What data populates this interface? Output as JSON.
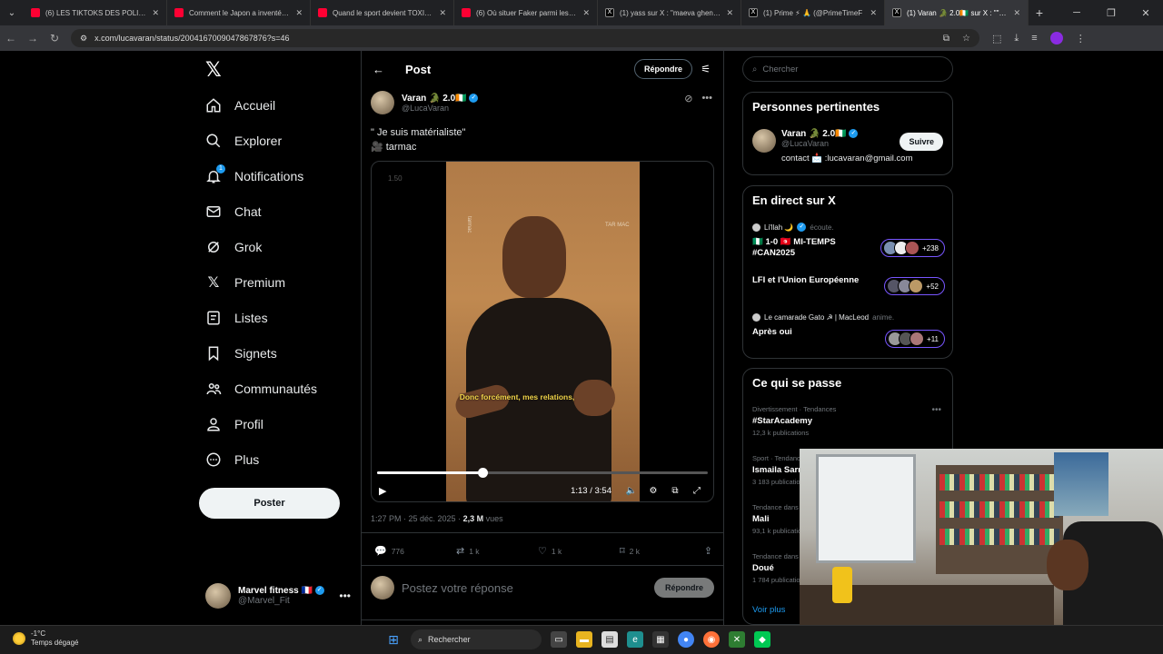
{
  "browser": {
    "tabs": [
      {
        "title": "(6) LES TIKTOKS DES POLITIQUE",
        "fav": "yt"
      },
      {
        "title": "Comment le Japon a inventé l'a",
        "fav": "yt"
      },
      {
        "title": "Quand le sport devient TOXIQU",
        "fav": "yt"
      },
      {
        "title": "(6) Où situer Faker parmi les lég",
        "fav": "yt"
      },
      {
        "title": "(1) yass sur X : \"maeva ghennan",
        "fav": "x"
      },
      {
        "title": "(1) Prime ⚡ 🙏 (@PrimeTimeF",
        "fav": "x"
      },
      {
        "title": "(1) Varan 🐊 2.0🇨🇮 sur X : \"\" Je s",
        "fav": "x",
        "active": true
      }
    ],
    "url": "x.com/lucavaran/status/2004167009047867876?s=46"
  },
  "sidebar": {
    "logo": "𝕏",
    "items": [
      {
        "label": "Accueil",
        "icon": "home-icon"
      },
      {
        "label": "Explorer",
        "icon": "search-icon"
      },
      {
        "label": "Notifications",
        "icon": "bell-icon",
        "badge": "1"
      },
      {
        "label": "Chat",
        "icon": "mail-icon"
      },
      {
        "label": "Grok",
        "icon": "grok-icon"
      },
      {
        "label": "Premium",
        "icon": "x-premium-icon"
      },
      {
        "label": "Listes",
        "icon": "list-icon"
      },
      {
        "label": "Signets",
        "icon": "bookmark-icon"
      },
      {
        "label": "Communautés",
        "icon": "communities-icon"
      },
      {
        "label": "Profil",
        "icon": "profile-icon"
      },
      {
        "label": "Plus",
        "icon": "more-icon"
      }
    ],
    "post_button": "Poster",
    "account": {
      "display_name": "Marvel fitness 🇫🇷",
      "handle": "@Marvel_Fit"
    }
  },
  "main": {
    "title": "Post",
    "reply_button": "Répondre",
    "author": {
      "display_name": "Varan 🐊 2.0🇨🇮",
      "handle": "@LucaVaran"
    },
    "text_line1": "\" Je suis matérialiste\"",
    "text_line2": "🎥 tarmac",
    "video": {
      "speed_label": "1.50",
      "caption": "Donc forcément, mes relations,",
      "time": "1:13 / 3:54",
      "progress": 0.32,
      "logo_left": "tarmac",
      "logo_right": "TAR MAC"
    },
    "meta": {
      "time": "1:27 PM · 25 déc. 2025 · ",
      "views": "2,3 M",
      "views_label": " vues"
    },
    "actions": {
      "replies": "776",
      "reposts": "1 k",
      "likes": "1 k",
      "bookmarks": "2 k"
    },
    "reply_placeholder": "Postez votre réponse",
    "reply_submit": "Répondre"
  },
  "right": {
    "search_placeholder": "Chercher",
    "relevant": {
      "title": "Personnes pertinentes",
      "display_name": "Varan 🐊 2.0🇨🇮",
      "handle": "@LucaVaran",
      "bio": "contact 📩 :lucavaran@gmail.com",
      "follow": "Suivre"
    },
    "live": {
      "title": "En direct sur X",
      "items": [
        {
          "host": "Li'llah 🌙",
          "host_sub": "écoute.",
          "title": "🇳🇬 1-0 🇹🇳 MI-TEMPS #CAN2025",
          "count": "+238"
        },
        {
          "host": "",
          "host_sub": "",
          "title": "LFI et l'Union Européenne",
          "count": "+52"
        },
        {
          "host": "Le camarade Gato ☭ | MacLeod",
          "host_sub": "anime.",
          "title": "Après oui",
          "count": "+11"
        }
      ]
    },
    "trends": {
      "title": "Ce qui se passe",
      "items": [
        {
          "context": "Divertissement · Tendances",
          "name": "#StarAcademy",
          "count": "12,3 k publications"
        },
        {
          "context": "Sport · Tendances",
          "name": "Ismaila Sarr",
          "count": "3 183 publications"
        },
        {
          "context": "Tendance dans",
          "name": "Mali",
          "count": "93,1 k publications"
        },
        {
          "context": "Tendance dans",
          "name": "Doué",
          "count": "1 784 publications"
        }
      ],
      "see_more": "Voir plus"
    }
  },
  "taskbar": {
    "temp": "-1°C",
    "weather": "Temps dégagé",
    "search": "Rechercher"
  }
}
